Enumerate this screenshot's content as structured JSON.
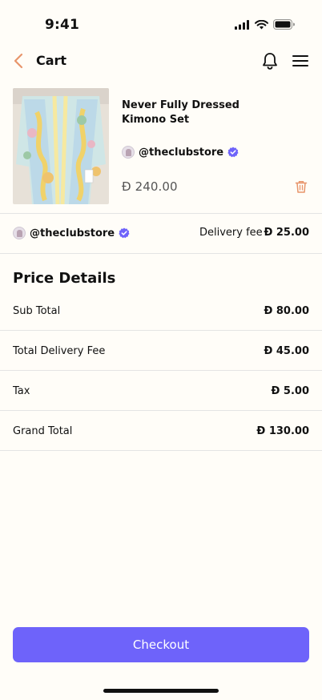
{
  "status": {
    "time": "9:41"
  },
  "header": {
    "title": "Cart"
  },
  "product": {
    "name": "Never Fully Dressed Kimono Set",
    "seller": "@theclubstore",
    "price": "Ð 240.00"
  },
  "delivery": {
    "seller": "@theclubstore",
    "label": "Delivery fee",
    "value": "Ð 25.00"
  },
  "price_details": {
    "title": "Price Details",
    "rows": [
      {
        "label": "Sub Total",
        "value": "Ð 80.00"
      },
      {
        "label": "Total Delivery Fee",
        "value": "Ð 45.00"
      },
      {
        "label": "Tax",
        "value": "Ð 5.00"
      },
      {
        "label": "Grand Total",
        "value": "Ð 130.00"
      }
    ]
  },
  "checkout": {
    "label": "Checkout"
  },
  "colors": {
    "accent": "#6E63FA",
    "back_arrow": "#E8956B",
    "trash": "#E8956B",
    "verified": "#6E63FA"
  },
  "icons": [
    "back-arrow-icon",
    "bell-icon",
    "menu-icon",
    "verified-icon",
    "trash-icon",
    "signal-icon",
    "wifi-icon",
    "battery-icon"
  ]
}
